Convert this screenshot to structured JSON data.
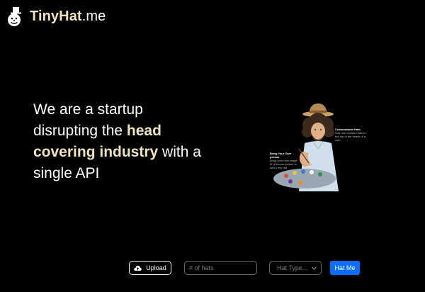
{
  "header": {
    "brand_main": "TinyHat",
    "brand_tld": ".me",
    "logo_icon": "snowman-top-hat-icon"
  },
  "hero": {
    "line_1": "We are a startup",
    "line_2_prefix": "disrupting the ",
    "line_2_highlight": "head",
    "line_3_highlight": "covering industry",
    "line_3_suffix": " with a",
    "line_4": "single API",
    "highlight_color": "#f1e2c2"
  },
  "illustration": {
    "callout_right": {
      "title": "Customizable Hats",
      "text": "Add user curated hats to the top of the heads of a user"
    },
    "callout_left": {
      "title": "Bring Your Own person",
      "text": "Bring your own image of a human person to add a tiny hat"
    }
  },
  "form": {
    "upload_label": "Upload",
    "upload_icon": "cloud-upload-icon",
    "hats_placeholder": "# of hats",
    "hat_type_selected": "Hat Type...",
    "submit_label": "Hat Me",
    "accent_color": "#0d6efd"
  }
}
